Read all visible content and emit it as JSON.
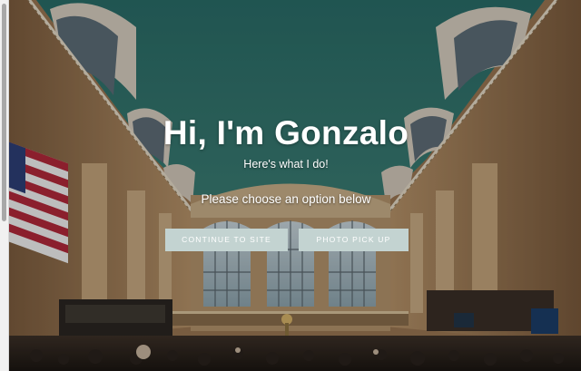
{
  "hero": {
    "title": "Hi, I'm Gonzalo",
    "subtitle": "Here's what I do!",
    "prompt": "Please choose an option below"
  },
  "buttons": {
    "continue_label": "CONTINUE TO SITE",
    "photo_label": "PHOTO PICK UP"
  },
  "colors": {
    "ceiling": "#2f6e68",
    "button_bg": "#c3d3d1",
    "text": "#ffffff",
    "stone": "#a5855e"
  }
}
